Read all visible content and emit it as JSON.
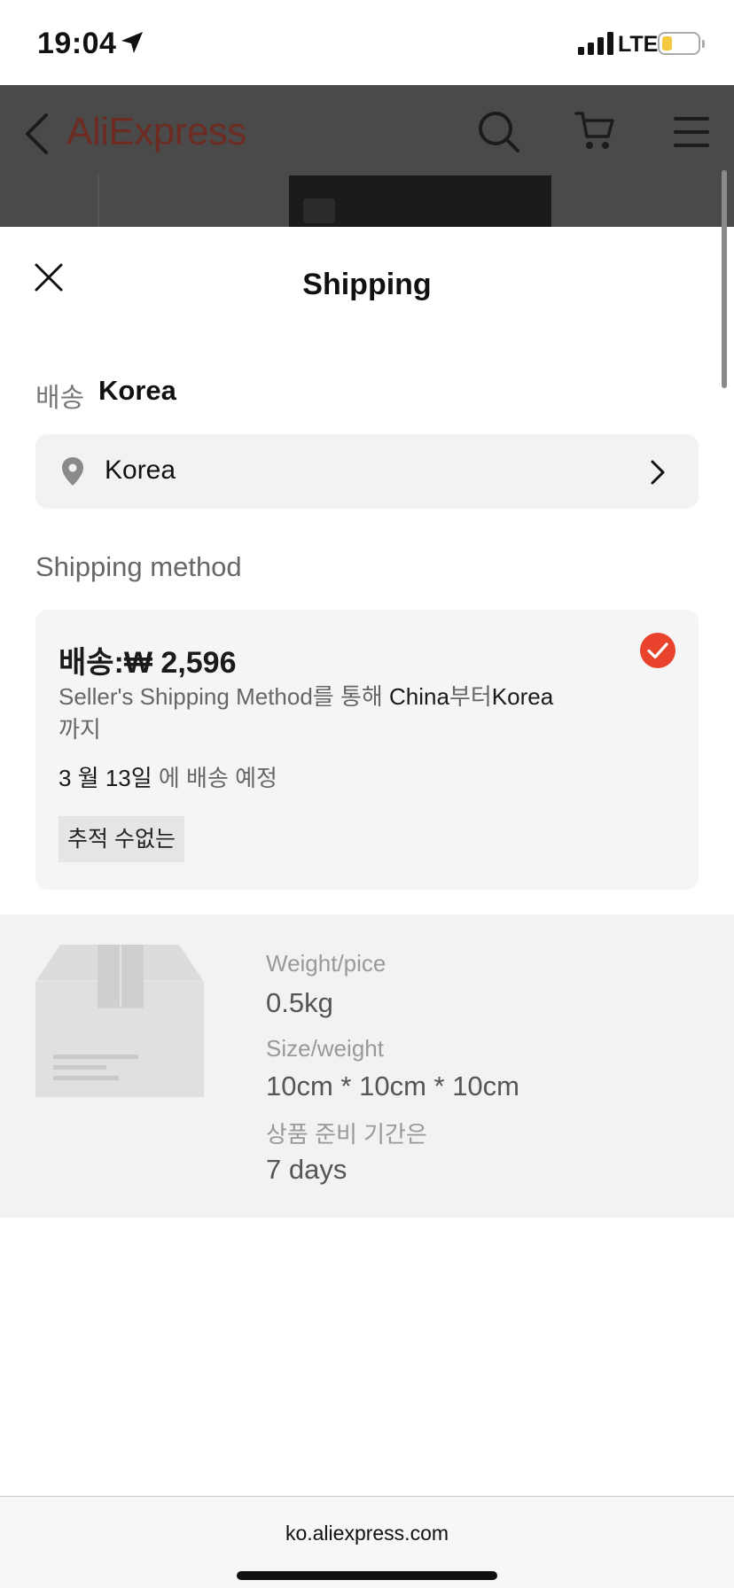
{
  "status_bar": {
    "time": "19:04",
    "network": "LTE",
    "battery_level": 0.3
  },
  "app_header": {
    "logo": "AliExpress"
  },
  "sheet": {
    "title": "Shipping",
    "ship_to_label": "배송",
    "ship_to_value": "Korea",
    "country_selector": "Korea",
    "method_section_label": "Shipping method",
    "method": {
      "price": "배송:₩ 2,596",
      "desc_prefix": "Seller's Shipping Method를 통해 ",
      "desc_from": "China",
      "desc_mid": "부터",
      "desc_to": "Korea",
      "desc_suffix": "까지",
      "eta_date": "3 월 13일",
      "eta_suffix": " 에 배송 예정",
      "tag": "추적 수없는",
      "selected": true
    },
    "info": {
      "weight_label": "Weight/pice",
      "weight_value": "0.5kg",
      "size_label": "Size/weight",
      "size_value": "10cm * 10cm * 10cm",
      "prep_label": "상품 준비 기간은",
      "prep_value": "7 days"
    }
  },
  "browser": {
    "url": "ko.aliexpress.com"
  },
  "colors": {
    "accent": "#e9432d",
    "logo_dimmed": "#6e2b22"
  }
}
